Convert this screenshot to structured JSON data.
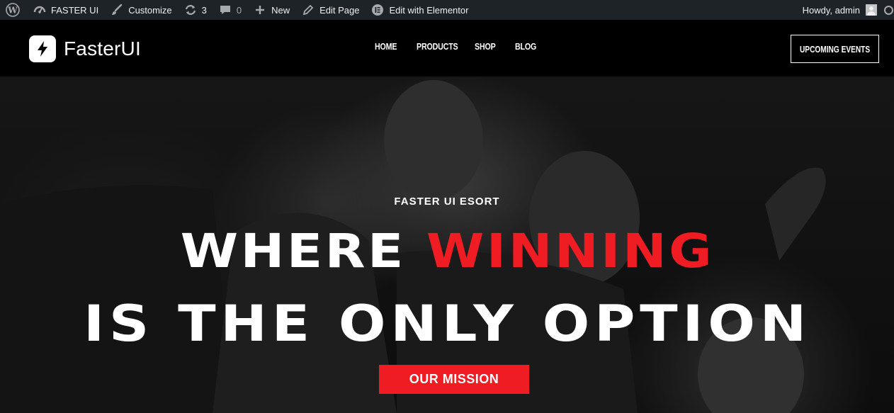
{
  "admin_bar": {
    "site_name": "FASTER UI",
    "customize": "Customize",
    "updates_count": "3",
    "comments_count": "0",
    "new": "New",
    "edit_page": "Edit Page",
    "edit_elementor": "Edit with Elementor",
    "howdy": "Howdy, admin",
    "icons": [
      "wordpress-icon",
      "dashboard-icon",
      "brush-icon",
      "updates-icon",
      "comment-icon",
      "plus-icon",
      "pencil-icon",
      "elementor-icon",
      "avatar",
      "search-icon"
    ]
  },
  "header": {
    "logo_text": "FasterUI",
    "logo_icon": "lightning-icon",
    "nav": [
      "HOME",
      "PRODUCTS",
      "SHOP",
      "BLOG"
    ],
    "cta": "UPCOMING EVENTS"
  },
  "hero": {
    "kicker": "FASTER UI ESORT",
    "line1_white": "WHERE",
    "line1_accent": "WINNING",
    "line2": "IS THE ONLY OPTION",
    "button": "OUR MISSION",
    "accent_color": "#f01c23"
  }
}
